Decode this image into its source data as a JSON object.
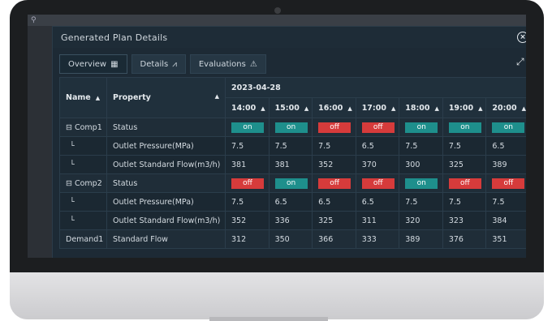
{
  "window": {
    "title": "Generated Plan Details"
  },
  "tabs": [
    {
      "label": "Overview",
      "icon": "table-icon",
      "active": true
    },
    {
      "label": "Details",
      "icon": "chart-icon",
      "active": false
    },
    {
      "label": "Evaluations",
      "icon": "warning-icon",
      "active": false
    }
  ],
  "table": {
    "col_name": "Name",
    "col_property": "Property",
    "date": "2023-04-28",
    "times": [
      "14:00",
      "15:00",
      "16:00",
      "17:00",
      "18:00",
      "19:00",
      "20:00"
    ],
    "rows": [
      {
        "name": "⊟ Comp1",
        "property": "Status",
        "values": [
          "on",
          "on",
          "off",
          "off",
          "on",
          "on",
          "on"
        ]
      },
      {
        "name": "└",
        "property": "Outlet Pressure(MPa)",
        "values": [
          "7.5",
          "7.5",
          "7.5",
          "6.5",
          "7.5",
          "7.5",
          "6.5"
        ]
      },
      {
        "name": "└",
        "property": "Outlet Standard Flow(m3/h)",
        "values": [
          "381",
          "381",
          "352",
          "370",
          "300",
          "325",
          "389"
        ]
      },
      {
        "name": "⊟ Comp2",
        "property": "Status",
        "values": [
          "off",
          "on",
          "off",
          "off",
          "on",
          "off",
          "off"
        ]
      },
      {
        "name": "└",
        "property": "Outlet Pressure(MPa)",
        "values": [
          "7.5",
          "6.5",
          "6.5",
          "6.5",
          "7.5",
          "7.5",
          "7.5"
        ]
      },
      {
        "name": "└",
        "property": "Outlet Standard Flow(m3/h)",
        "values": [
          "352",
          "336",
          "325",
          "311",
          "320",
          "323",
          "384"
        ]
      },
      {
        "name": "Demand1",
        "property": "Standard Flow",
        "values": [
          "312",
          "350",
          "366",
          "333",
          "389",
          "376",
          "351"
        ]
      }
    ]
  },
  "colors": {
    "on": "#1e8f8c",
    "off": "#d63b3b",
    "panel": "#1d2a35"
  }
}
